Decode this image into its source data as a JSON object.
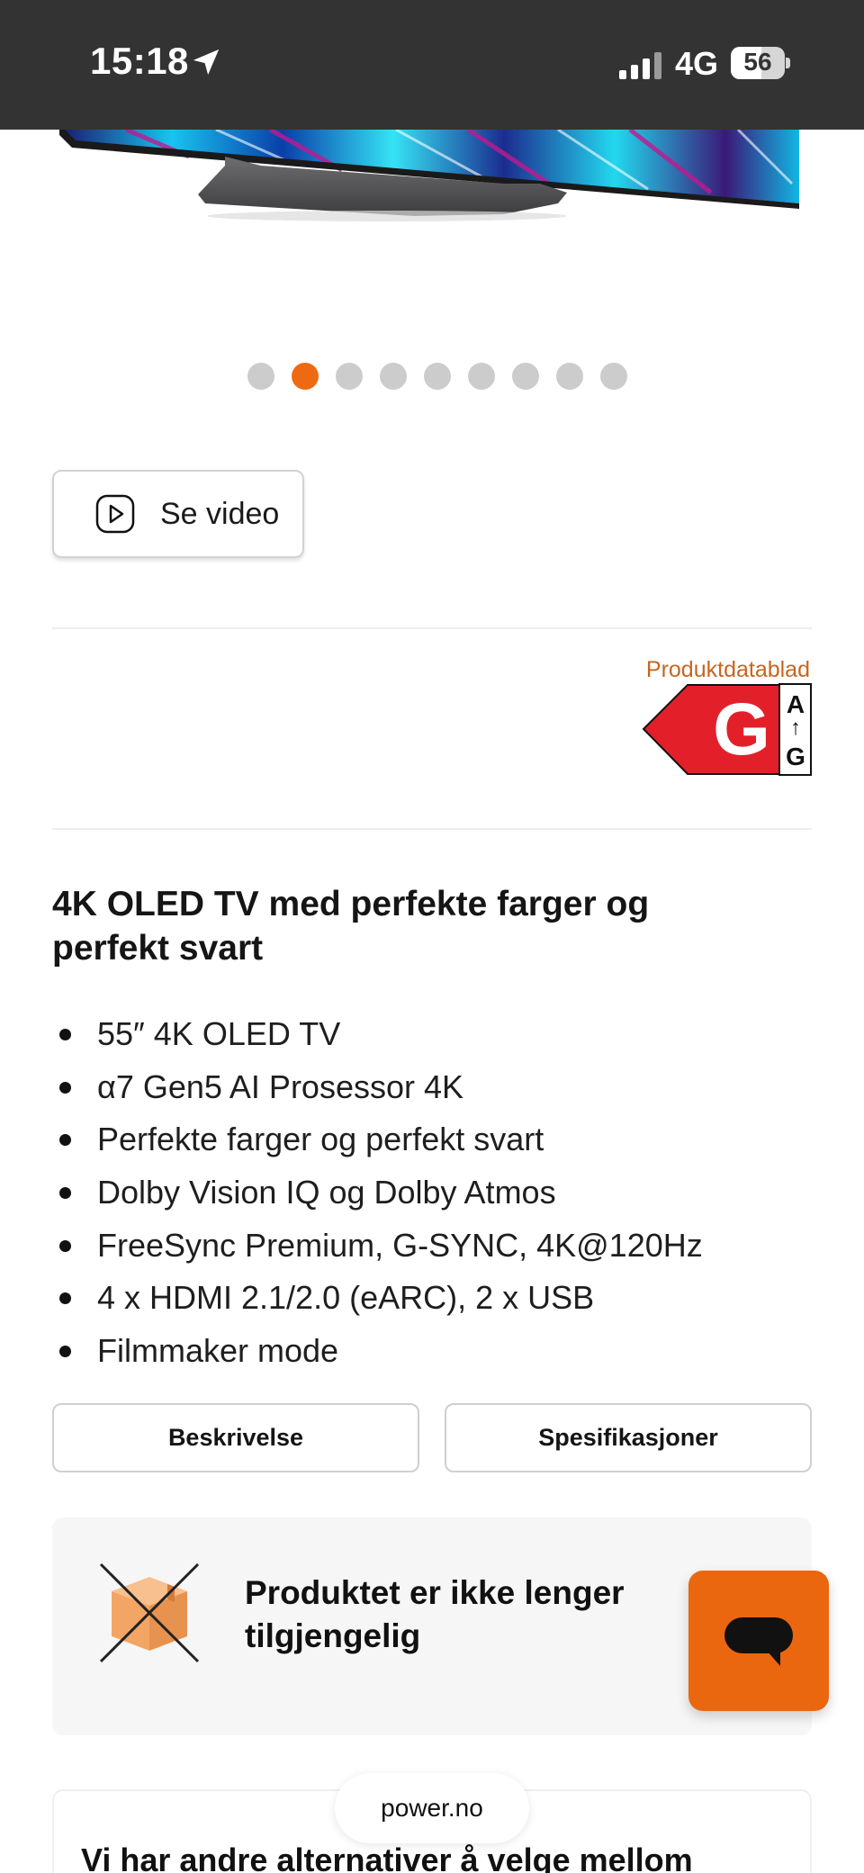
{
  "status_bar": {
    "time": "15:18",
    "network": "4G",
    "battery_percent": "56",
    "battery_level": 0.56
  },
  "carousel": {
    "dot_count": 9,
    "active_index": 1,
    "active_color": "#ee6a12",
    "inactive_color": "#cccccc"
  },
  "video_button": {
    "label": "Se video",
    "icon": "play-circle-icon"
  },
  "energy": {
    "datasheet_link": "Produktdatablad",
    "class": "G",
    "scale_top": "A",
    "scale_arrow": "↑",
    "scale_bottom": "G",
    "color": "#e3202a"
  },
  "product": {
    "heading": "4K OLED TV med perfekte farger og perfekt svart",
    "features": [
      "55″ 4K OLED TV",
      "α7 Gen5 AI Prosessor 4K",
      "Perfekte farger og perfekt svart",
      "Dolby Vision IQ og Dolby Atmos",
      "FreeSync Premium, G-SYNC, 4K@120Hz",
      "4 x HDMI 2.1/2.0 (eARC), 2 x USB",
      "Filmmaker mode"
    ]
  },
  "tabs": {
    "description": "Beskrivelse",
    "specifications": "Spesifikasjoner"
  },
  "availability": {
    "message": "Produktet er ikke lenger tilgjengelig",
    "icon": "crossed-box-icon"
  },
  "chat": {
    "icon": "chat-bubble-icon",
    "color": "#ea6710"
  },
  "alternatives": {
    "heading": "Vi har andre alternativer å velge mellom"
  },
  "browser": {
    "domain": "power.no"
  }
}
